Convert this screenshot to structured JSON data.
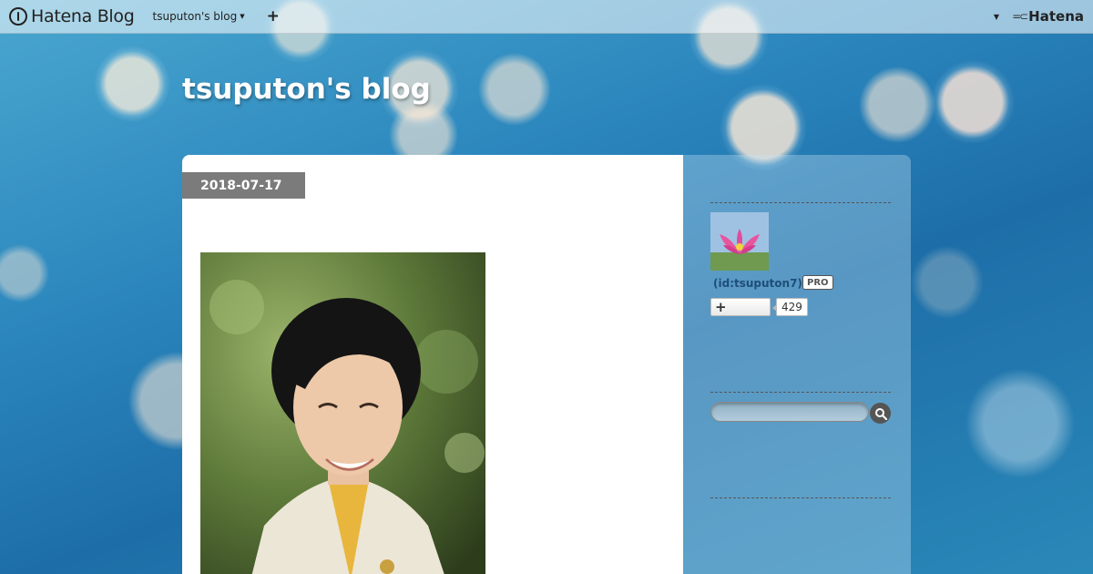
{
  "globalnav": {
    "brand": "Hatena Blog",
    "blog_switch": "tsuputon's blog",
    "add": "+",
    "hatena": "Hatena"
  },
  "blog": {
    "title": "tsuputon's blog"
  },
  "entry": {
    "date": "2018-07-17"
  },
  "sidebar": {
    "user_id": "(id:tsuputon7)",
    "pro_badge": "PRO",
    "follow_label": "+",
    "follower_count": "429",
    "search_placeholder": ""
  },
  "icons": {
    "brand_logo": "hatena-blog-logo-icon",
    "caret": "caret-down-icon",
    "search": "search-icon",
    "hatena_mark": "hatena-logo-icon"
  },
  "colors": {
    "date_badge": "#7b7b7b",
    "user_link": "#1d4e78",
    "background": "#2b86bd"
  }
}
